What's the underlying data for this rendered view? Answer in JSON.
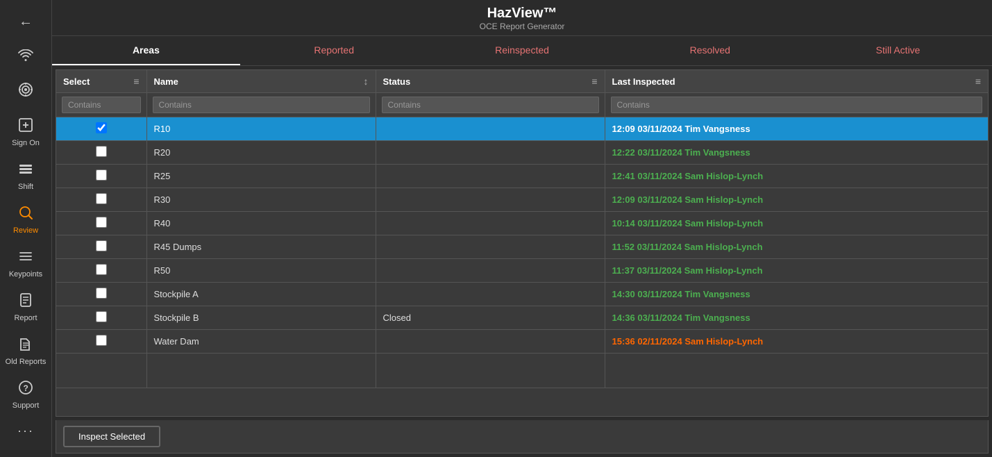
{
  "app": {
    "title": "HazView™",
    "subtitle": "OCE Report Generator"
  },
  "sidebar": {
    "items": [
      {
        "id": "back",
        "label": "",
        "icon": "←",
        "active": false
      },
      {
        "id": "wifi",
        "label": "",
        "icon": "📶",
        "active": false
      },
      {
        "id": "target",
        "label": "",
        "icon": "🎯",
        "active": false
      },
      {
        "id": "sign-on",
        "label": "Sign On",
        "icon": "👤",
        "active": false
      },
      {
        "id": "shift",
        "label": "Shift",
        "icon": "📊",
        "active": false
      },
      {
        "id": "review",
        "label": "Review",
        "icon": "🔍",
        "active": true
      },
      {
        "id": "keypoints",
        "label": "Keypoints",
        "icon": "☰",
        "active": false
      },
      {
        "id": "report",
        "label": "Report",
        "icon": "📋",
        "active": false
      },
      {
        "id": "old-reports",
        "label": "Old Reports",
        "icon": "🗂",
        "active": false
      },
      {
        "id": "support",
        "label": "Support",
        "icon": "❓",
        "active": false
      },
      {
        "id": "more",
        "label": "...",
        "icon": "···",
        "active": false
      }
    ]
  },
  "nav": {
    "tabs": [
      {
        "id": "areas",
        "label": "Areas",
        "active": true
      },
      {
        "id": "reported",
        "label": "Reported",
        "active": false
      },
      {
        "id": "reinspected",
        "label": "Reinspected",
        "active": false
      },
      {
        "id": "resolved",
        "label": "Resolved",
        "active": false
      },
      {
        "id": "still-active",
        "label": "Still Active",
        "active": false
      }
    ]
  },
  "table": {
    "columns": [
      {
        "id": "select",
        "label": "Select"
      },
      {
        "id": "name",
        "label": "Name"
      },
      {
        "id": "status",
        "label": "Status"
      },
      {
        "id": "last-inspected",
        "label": "Last Inspected"
      }
    ],
    "filters": {
      "select": "Contains",
      "name": "Contains",
      "status": "Contains",
      "last_inspected": "Contains"
    },
    "rows": [
      {
        "id": "R10",
        "name": "R10",
        "status": "",
        "last_inspected": "12:09 03/11/2024 Tim Vangsness",
        "last_inspected_color": "green",
        "selected": true
      },
      {
        "id": "R20",
        "name": "R20",
        "status": "",
        "last_inspected": "12:22 03/11/2024 Tim Vangsness",
        "last_inspected_color": "green",
        "selected": false
      },
      {
        "id": "R25",
        "name": "R25",
        "status": "",
        "last_inspected": "12:41 03/11/2024 Sam Hislop-Lynch",
        "last_inspected_color": "green",
        "selected": false
      },
      {
        "id": "R30",
        "name": "R30",
        "status": "",
        "last_inspected": "12:09 03/11/2024 Sam Hislop-Lynch",
        "last_inspected_color": "green",
        "selected": false
      },
      {
        "id": "R40",
        "name": "R40",
        "status": "",
        "last_inspected": "10:14 03/11/2024 Sam Hislop-Lynch",
        "last_inspected_color": "green",
        "selected": false
      },
      {
        "id": "R45-Dumps",
        "name": "R45 Dumps",
        "status": "",
        "last_inspected": "11:52 03/11/2024 Sam Hislop-Lynch",
        "last_inspected_color": "green",
        "selected": false
      },
      {
        "id": "R50",
        "name": "R50",
        "status": "",
        "last_inspected": "11:37 03/11/2024 Sam Hislop-Lynch",
        "last_inspected_color": "green",
        "selected": false
      },
      {
        "id": "Stockpile-A",
        "name": "Stockpile A",
        "status": "",
        "last_inspected": "14:30 03/11/2024 Tim Vangsness",
        "last_inspected_color": "green",
        "selected": false
      },
      {
        "id": "Stockpile-B",
        "name": "Stockpile B",
        "status": "Closed",
        "last_inspected": "14:36 03/11/2024 Tim Vangsness",
        "last_inspected_color": "green",
        "selected": false
      },
      {
        "id": "Water-Dam",
        "name": "Water Dam",
        "status": "",
        "last_inspected": "15:36 02/11/2024 Sam Hislop-Lynch",
        "last_inspected_color": "orange",
        "selected": false
      }
    ]
  },
  "buttons": {
    "inspect_selected": "Inspect Selected"
  }
}
